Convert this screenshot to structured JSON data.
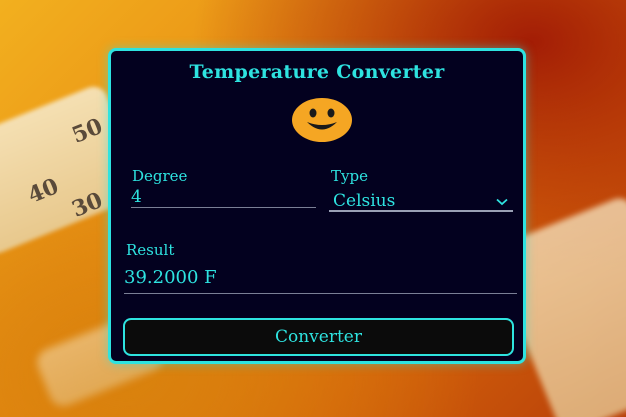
{
  "card": {
    "title": "Temperature Converter",
    "mood_icon": "smiley-face-icon",
    "degree": {
      "label": "Degree",
      "value": "4"
    },
    "type": {
      "label": "Type",
      "selected": "Celsius"
    },
    "result": {
      "label": "Result",
      "value": "39.2000 F"
    },
    "convert_button_label": "Converter"
  },
  "background": {
    "thermometer_ticks": [
      "50",
      "40",
      "30"
    ]
  },
  "colors": {
    "accent": "#2ee3e0",
    "card_bg": "#03011f",
    "smiley": "#f5a623"
  }
}
